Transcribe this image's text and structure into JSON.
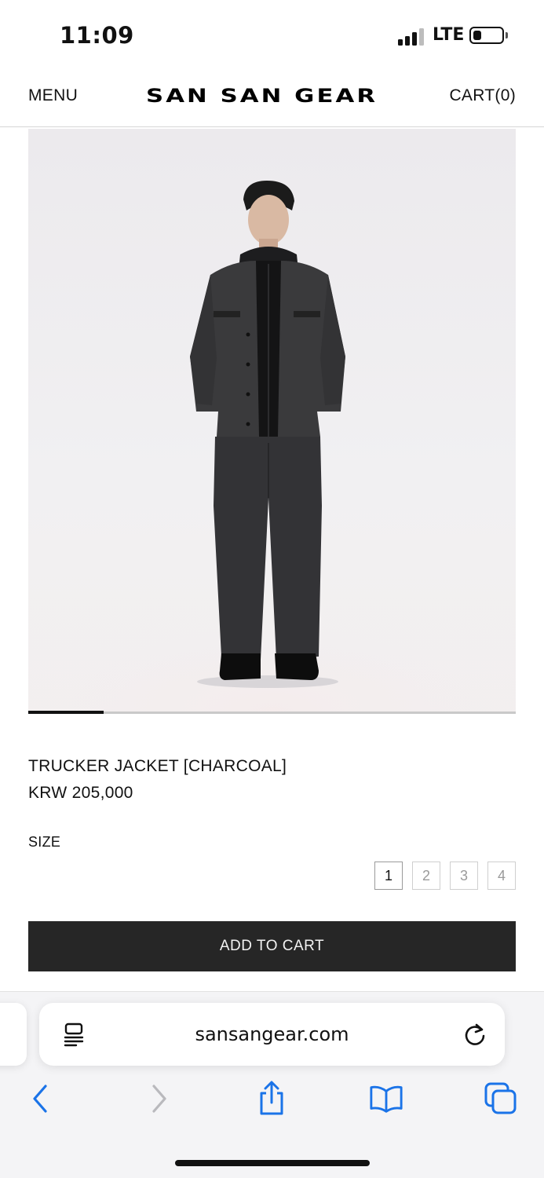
{
  "status_bar": {
    "time": "11:09",
    "network": "LTE",
    "icons": [
      "cellular-signal-icon",
      "battery-icon"
    ]
  },
  "header": {
    "menu_label": "MENU",
    "logo": "SAN SAN GEAR",
    "cart_label": "CART(0)"
  },
  "product": {
    "image_alt": "model-wearing-charcoal-trucker-jacket",
    "carousel_progress": 0.155,
    "name": "TRUCKER JACKET [CHARCOAL]",
    "price": "KRW 205,000",
    "size_label": "SIZE",
    "sizes": [
      "1",
      "2",
      "3",
      "4"
    ],
    "selected_size": "1",
    "add_to_cart_label": "ADD TO CART"
  },
  "browser": {
    "url": "sansangear.com",
    "icons": [
      "reader-mode-icon",
      "reload-icon",
      "back-icon",
      "forward-icon",
      "share-icon",
      "bookmarks-icon",
      "tabs-icon"
    ]
  },
  "colors": {
    "accent": "#1a73e8",
    "button_bg": "#262626",
    "page_bg": "#ffffff",
    "chrome_bg": "#f4f4f6"
  }
}
